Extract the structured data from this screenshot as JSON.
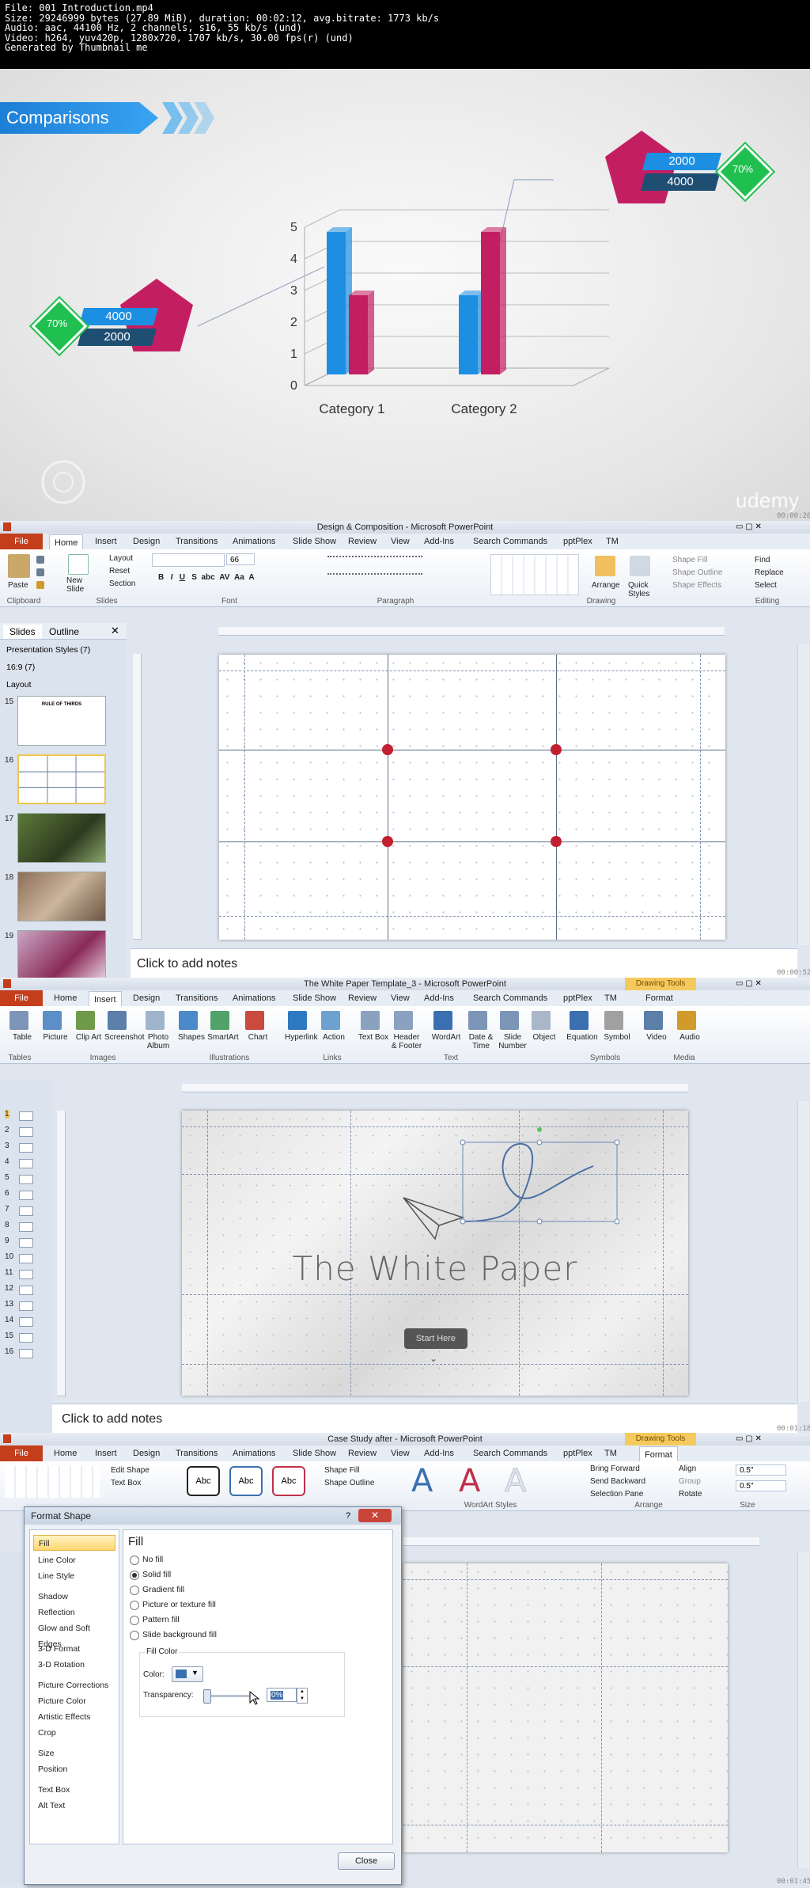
{
  "header": {
    "lines": [
      "File: 001 Introduction.mp4",
      "Size: 29246999 bytes (27.89 MiB), duration: 00:02:12, avg.bitrate: 1773 kb/s",
      "Audio: aac, 44100 Hz, 2 channels, s16, 55 kb/s (und)",
      "Video: h264, yuv420p, 1280x720, 1707 kb/s, 30.00 fps(r) (und)",
      "Generated by Thumbnail me"
    ]
  },
  "frame1": {
    "banner": "Comparisons",
    "left_badge": {
      "percent": "70%",
      "top": "4000",
      "bottom": "2000"
    },
    "right_badge": {
      "percent": "70%",
      "top": "2000",
      "bottom": "4000"
    },
    "watermark": "udemy",
    "timestamp": "00:00:26",
    "chart_data": {
      "type": "bar",
      "categories": [
        "Category 1",
        "Category 2"
      ],
      "series": [
        {
          "values": [
            4.5,
            2.5
          ],
          "color": "#1c8fe3"
        },
        {
          "values": [
            2.5,
            4.5
          ],
          "color": "#c41e63"
        }
      ],
      "ylim": [
        0,
        5
      ],
      "yticks": [
        "0",
        "1",
        "2",
        "3",
        "4",
        "5"
      ],
      "grid": true
    }
  },
  "frame2": {
    "title": "Design & Composition - Microsoft PowerPoint",
    "tabs": [
      "File",
      "Home",
      "Insert",
      "Design",
      "Transitions",
      "Animations",
      "Slide Show",
      "Review",
      "View",
      "Add-Ins",
      "Search Commands",
      "pptPlex",
      "TM"
    ],
    "groups": [
      "Clipboard",
      "Slides",
      "Font",
      "Paragraph",
      "Drawing",
      "Editing"
    ],
    "ribbon": {
      "paste": "Paste",
      "new_slide": "New Slide",
      "layout": "Layout",
      "reset": "Reset",
      "section": "Section",
      "font_size": "66",
      "arrange": "Arrange",
      "quick_styles": "Quick Styles",
      "shape_fill": "Shape Fill",
      "shape_outline": "Shape Outline",
      "shape_effects": "Shape Effects",
      "find": "Find",
      "replace": "Replace",
      "select": "Select"
    },
    "panel_tabs": [
      "Slides",
      "Outline"
    ],
    "sections": [
      "Presentation Styles (7)",
      "16:9 (7)",
      "Layout"
    ],
    "thumbs": [
      {
        "num": "15",
        "text": "RULE OF THIRDS"
      },
      {
        "num": "16",
        "text": ""
      },
      {
        "num": "17",
        "text": ""
      },
      {
        "num": "18",
        "text": ""
      },
      {
        "num": "19",
        "text": ""
      }
    ],
    "notes": "Click to add notes",
    "timestamp": "00:00:52"
  },
  "frame3": {
    "title": "The White Paper Template_3 - Microsoft PowerPoint",
    "context_tab": "Drawing Tools",
    "tabs": [
      "File",
      "Home",
      "Insert",
      "Design",
      "Transitions",
      "Animations",
      "Slide Show",
      "Review",
      "View",
      "Add-Ins",
      "Search Commands",
      "pptPlex",
      "TM",
      "Format"
    ],
    "buttons": [
      "Table",
      "Picture",
      "Clip Art",
      "Screenshot",
      "Photo Album",
      "Shapes",
      "SmartArt",
      "Chart",
      "Hyperlink",
      "Action",
      "Text Box",
      "Header & Footer",
      "WordArt",
      "Date & Time",
      "Slide Number",
      "Object",
      "Equation",
      "Symbol",
      "Video",
      "Audio"
    ],
    "groups": [
      "Tables",
      "Images",
      "Illustrations",
      "Links",
      "Text",
      "Symbols",
      "Media"
    ],
    "slide_numbers": [
      "1",
      "2",
      "3",
      "4",
      "5",
      "6",
      "7",
      "8",
      "9",
      "10",
      "11",
      "12",
      "13",
      "14",
      "15",
      "16"
    ],
    "slide_title": "The White Paper",
    "slide_button": "Start Here",
    "notes": "Click to add notes",
    "timestamp": "00:01:18"
  },
  "frame4": {
    "title": "Case Study after - Microsoft PowerPoint",
    "context_tab": "Drawing Tools",
    "tabs": [
      "File",
      "Home",
      "Insert",
      "Design",
      "Transitions",
      "Animations",
      "Slide Show",
      "Review",
      "View",
      "Add-Ins",
      "Search Commands",
      "pptPlex",
      "TM",
      "Format"
    ],
    "ribbon": {
      "edit_shape": "Edit Shape",
      "text_box": "Text Box",
      "abc": "Abc",
      "shape_fill": "Shape Fill",
      "shape_outline": "Shape Outline",
      "wordart_group": "WordArt Styles",
      "bring_forward": "Bring Forward",
      "send_backward": "Send Backward",
      "selection_pane": "Selection Pane",
      "align": "Align",
      "group": "Group",
      "rotate": "Rotate",
      "arrange_group": "Arrange",
      "size_group": "Size",
      "height": "0.5\"",
      "width": "0.5\""
    },
    "dialog": {
      "title": "Format Shape",
      "nav": [
        "Fill",
        "Line Color",
        "Line Style",
        "Shadow",
        "Reflection",
        "Glow and Soft Edges",
        "3-D Format",
        "3-D Rotation",
        "Picture Corrections",
        "Picture Color",
        "Artistic Effects",
        "Crop",
        "Size",
        "Position",
        "Text Box",
        "Alt Text"
      ],
      "section": "Fill",
      "options": [
        "No fill",
        "Solid fill",
        "Gradient fill",
        "Picture or texture fill",
        "Pattern fill",
        "Slide background fill"
      ],
      "selected_option": "Solid fill",
      "fill_color_label": "Fill Color",
      "color_label": "Color:",
      "transparency_label": "Transparency:",
      "transparency_value": "0%",
      "close": "Close"
    },
    "timestamp": "00:01:45"
  }
}
